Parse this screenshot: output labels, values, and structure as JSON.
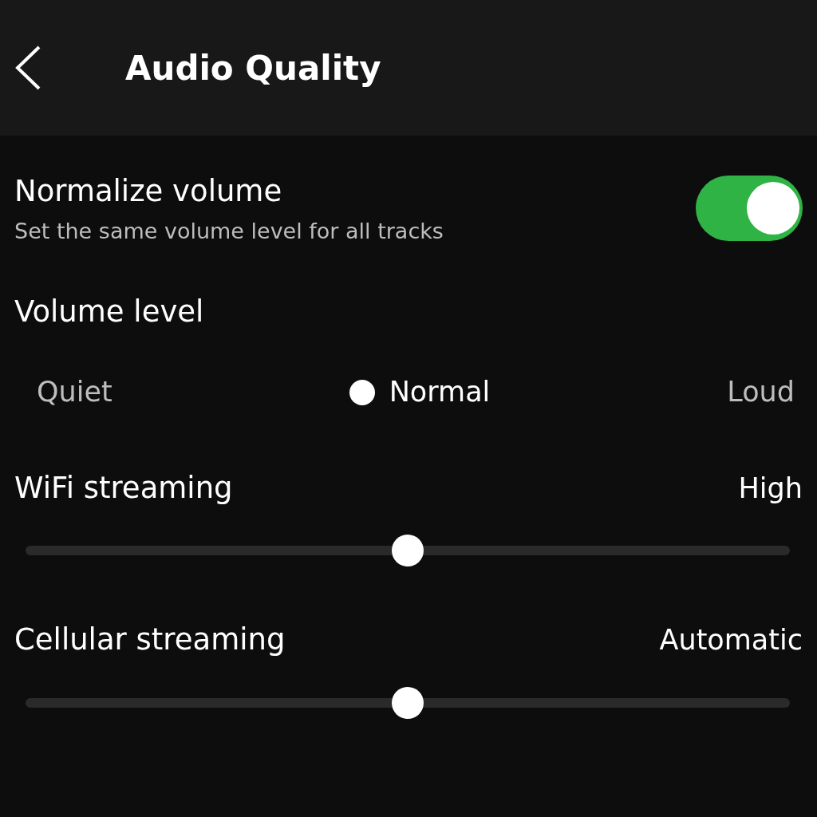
{
  "header": {
    "title": "Audio Quality"
  },
  "normalize": {
    "title": "Normalize volume",
    "description": "Set the same volume level for all tracks",
    "on": true
  },
  "volume_level": {
    "title": "Volume level",
    "options": [
      {
        "label": "Quiet",
        "selected": false
      },
      {
        "label": "Normal",
        "selected": true
      },
      {
        "label": "Loud",
        "selected": false
      }
    ]
  },
  "streaming": [
    {
      "title": "WiFi streaming",
      "value": "High",
      "level": 0.5
    },
    {
      "title": "Cellular streaming",
      "value": "Automatic",
      "level": 0.5
    }
  ]
}
